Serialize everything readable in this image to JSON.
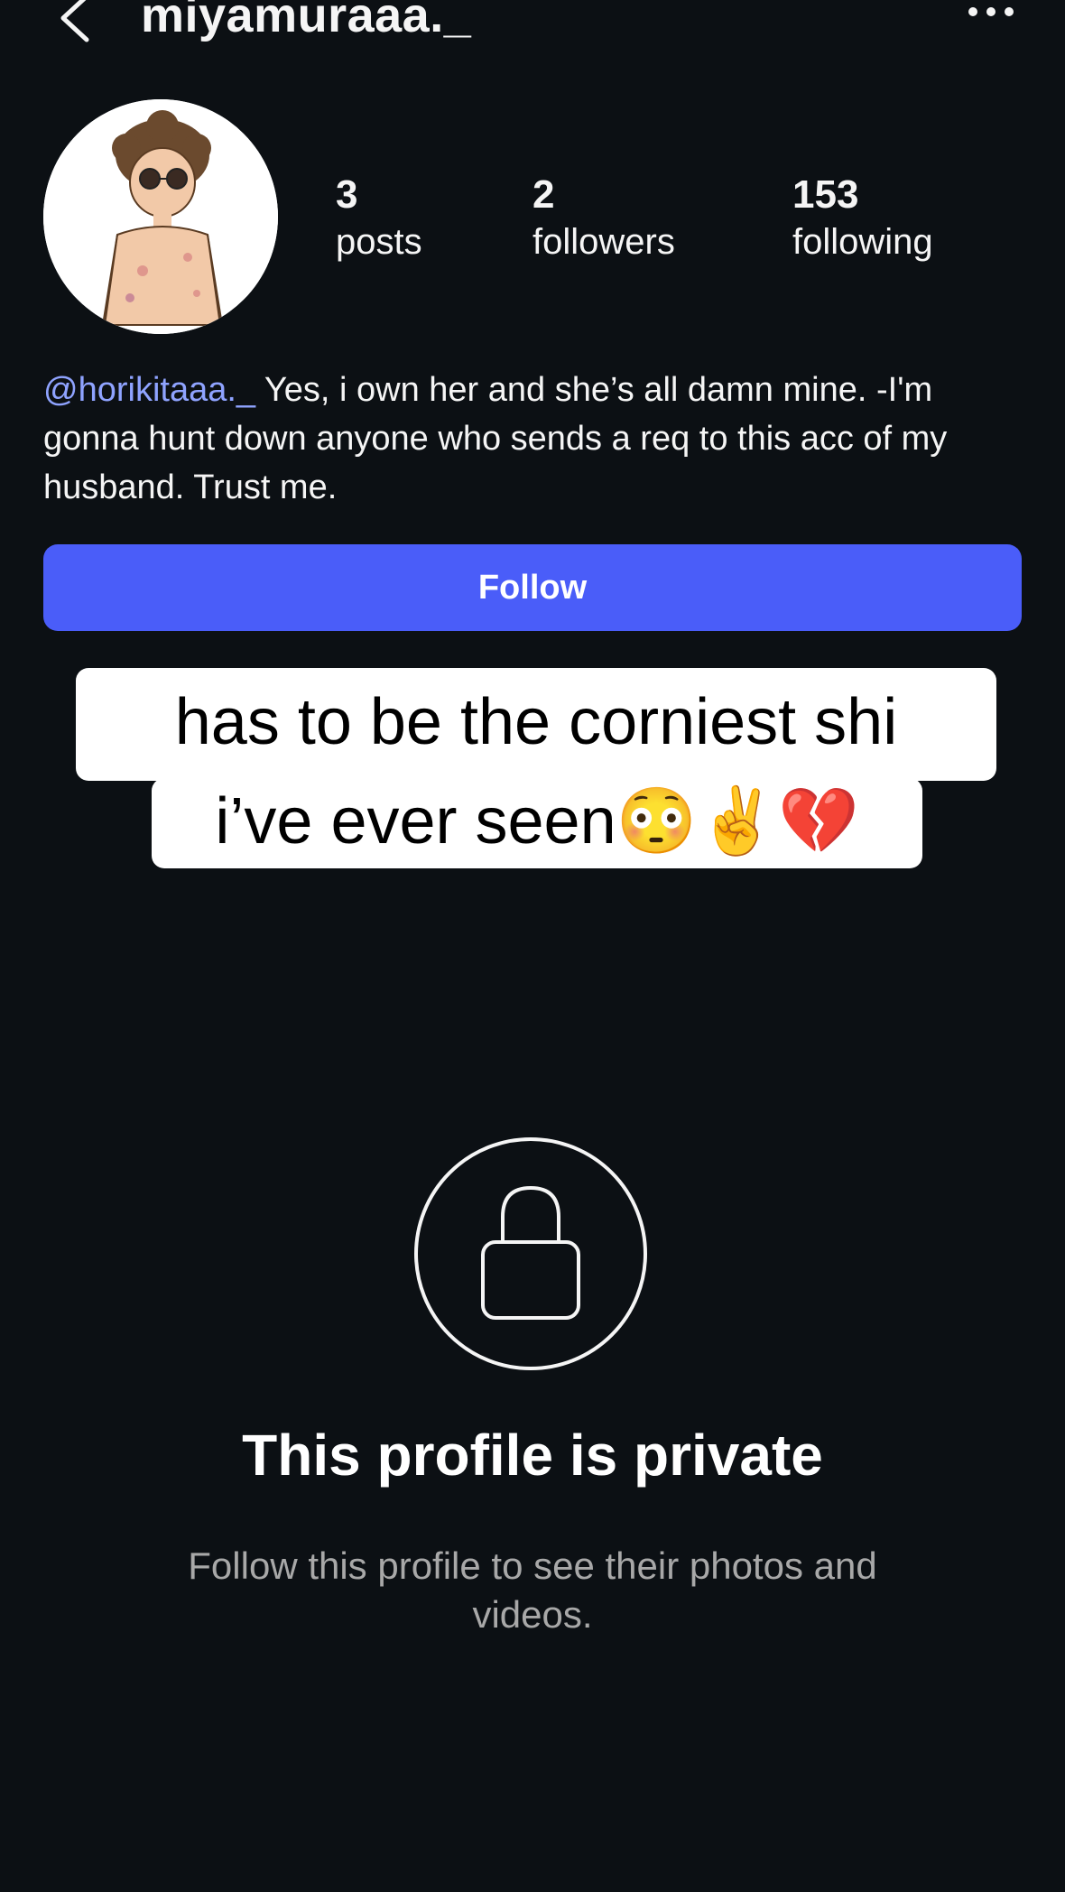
{
  "header": {
    "username": "miyamuraaa._",
    "back_icon": "chevron-left-icon",
    "more_icon": "more-horizontal-icon"
  },
  "stats": {
    "posts": {
      "count": "3",
      "label": "posts"
    },
    "followers": {
      "count": "2",
      "label": "followers"
    },
    "following": {
      "count": "153",
      "label": "following"
    }
  },
  "bio": {
    "mention": "@horikitaaa._",
    "text_after_mention": " Yes, i own her and she’s all damn mine. -I'm gonna hunt down anyone who sends a req to this acc of my husband. Trust me."
  },
  "follow_button": {
    "label": "Follow",
    "color": "#4a5df9"
  },
  "caption_overlay": {
    "line1": "has to be the corniest shi",
    "line2": "i’ve ever seen😳✌️💔"
  },
  "private_notice": {
    "icon": "lock-icon",
    "title": "This profile is private",
    "subtitle": "Follow this profile to see their photos and videos."
  },
  "colors": {
    "background": "#0c1014",
    "text": "#f5f5f5",
    "mention": "#8fa3ff",
    "muted": "#a8a8a8"
  }
}
